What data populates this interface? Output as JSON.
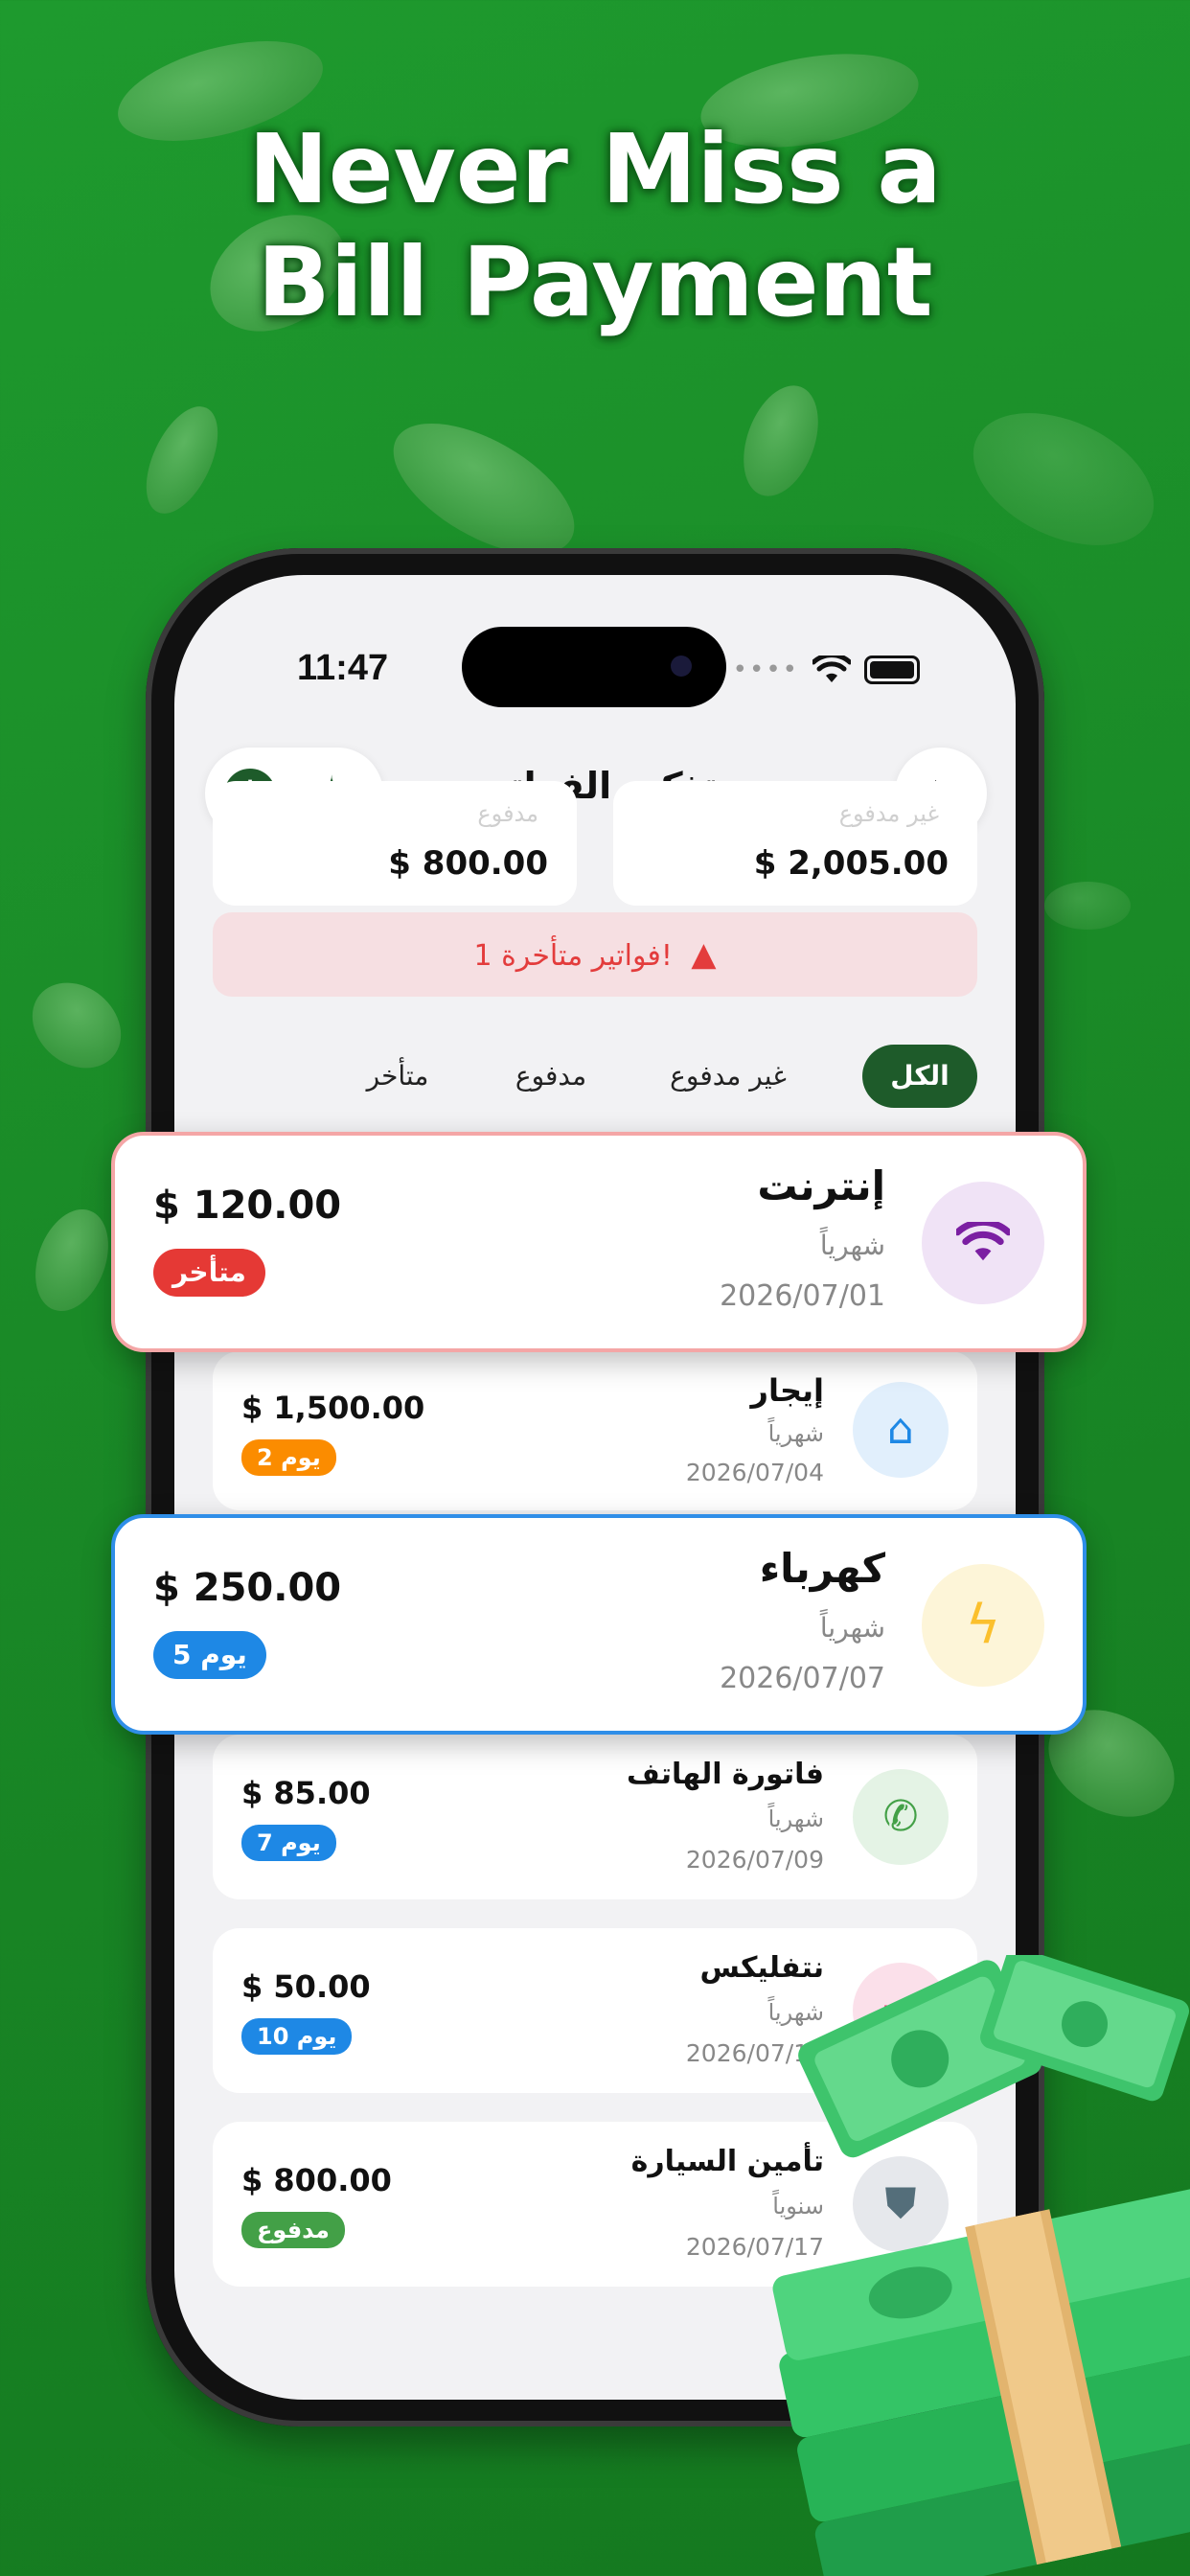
{
  "headline": {
    "line1": "Never Miss a",
    "line2": "Bill Payment"
  },
  "status": {
    "time": "11:47"
  },
  "header": {
    "title": "تذكير الفواتير",
    "add_icon": "plus-icon",
    "magic_icon": "magic-wand-icon",
    "next_icon": "chevron-right-icon"
  },
  "summary": [
    {
      "label": "مدفوع",
      "value": "$ 800.00"
    },
    {
      "label": "غير مدفوع",
      "value": "$ 2,005.00"
    }
  ],
  "alert": {
    "text": "1 فواتير متأخرة!",
    "icon": "warning-icon"
  },
  "tabs": [
    {
      "label": "الكل",
      "active": true
    },
    {
      "label": "غير مدفوع"
    },
    {
      "label": "مدفوع"
    },
    {
      "label": "متأخر"
    }
  ],
  "bills": [
    {
      "name": "إنترنت",
      "freq": "شهرياً",
      "date": "2026/07/01",
      "amount": "$ 120.00",
      "badge": "متأخر",
      "badge_color": "#e53935",
      "icon": "wifi-icon",
      "icon_bg": "#f0e3f6",
      "icon_color": "#7b1fa2",
      "border": "#f4a6a6"
    },
    {
      "name": "إيجار",
      "freq": "شهرياً",
      "date": "2026/07/04",
      "amount": "$ 1,500.00",
      "badge": "2 يوم",
      "badge_color": "#fb8c00",
      "icon": "home-icon",
      "icon_bg": "#e1effc",
      "icon_color": "#1e88e5"
    },
    {
      "name": "كهرباء",
      "freq": "شهرياً",
      "date": "2026/07/07",
      "amount": "$ 250.00",
      "badge": "5 يوم",
      "badge_color": "#1e88e5",
      "icon": "lightning-icon",
      "icon_bg": "#fdf5d8",
      "icon_color": "#fbc02d",
      "border": "#2f8ee8"
    },
    {
      "name": "فاتورة الهاتف",
      "freq": "شهرياً",
      "date": "2026/07/09",
      "amount": "$ 85.00",
      "badge": "7 يوم",
      "badge_color": "#1e88e5",
      "icon": "phone-icon",
      "icon_bg": "#e4f3e5",
      "icon_color": "#43a047"
    },
    {
      "name": "نتفليكس",
      "freq": "شهرياً",
      "date": "2026/07/12",
      "amount": "$ 50.00",
      "badge": "10 يوم",
      "badge_color": "#1e88e5",
      "icon": "tv-icon",
      "icon_bg": "#fbe0ea",
      "icon_color": "#e91e63"
    },
    {
      "name": "تأمين السيارة",
      "freq": "سنوياً",
      "date": "2026/07/17",
      "amount": "$ 800.00",
      "badge": "مدفوع",
      "badge_color": "#43a047",
      "icon": "shield-icon",
      "icon_bg": "#e6e8ec",
      "icon_color": "#546e7a"
    }
  ]
}
